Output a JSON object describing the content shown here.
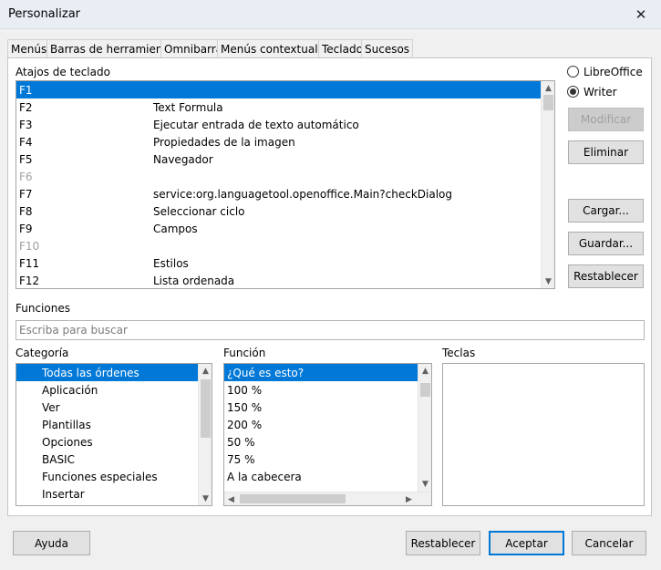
{
  "window": {
    "title": "Personalizar",
    "close_glyph": "✕"
  },
  "tabs": [
    {
      "label": "Menús"
    },
    {
      "label": "Barras de herramientas"
    },
    {
      "label": "Omnibarra"
    },
    {
      "label": "Menús contextuales"
    },
    {
      "label": "Teclado",
      "active": true
    },
    {
      "label": "Sucesos"
    }
  ],
  "shortcuts": {
    "label": "Atajos de teclado",
    "rows": [
      {
        "key": "F1",
        "func": "",
        "selected": true
      },
      {
        "key": "F2",
        "func": "Text Formula"
      },
      {
        "key": "F3",
        "func": "Ejecutar entrada de texto automático"
      },
      {
        "key": "F4",
        "func": "Propiedades de la imagen"
      },
      {
        "key": "F5",
        "func": "Navegador"
      },
      {
        "key": "F6",
        "func": "",
        "disabled": true
      },
      {
        "key": "F7",
        "func": "service:org.languagetool.openoffice.Main?checkDialog"
      },
      {
        "key": "F8",
        "func": "Seleccionar ciclo"
      },
      {
        "key": "F9",
        "func": "Campos"
      },
      {
        "key": "F10",
        "func": "",
        "disabled": true
      },
      {
        "key": "F11",
        "func": "Estilos"
      },
      {
        "key": "F12",
        "func": "Lista ordenada"
      }
    ]
  },
  "scope": {
    "libreoffice_label": "LibreOffice",
    "writer_label": "Writer",
    "selected": "writer"
  },
  "side_buttons": {
    "modificar": "Modificar",
    "eliminar": "Eliminar",
    "cargar": "Cargar...",
    "guardar": "Guardar...",
    "restablecer": "Restablecer"
  },
  "functions": {
    "label": "Funciones",
    "search_placeholder": "Escriba para buscar"
  },
  "categoria": {
    "label": "Categoría",
    "items": [
      {
        "text": "Todas las órdenes",
        "selected": true
      },
      {
        "text": "Aplicación"
      },
      {
        "text": "Ver"
      },
      {
        "text": "Plantillas"
      },
      {
        "text": "Opciones"
      },
      {
        "text": "BASIC"
      },
      {
        "text": "Funciones especiales"
      },
      {
        "text": "Insertar"
      }
    ]
  },
  "funcion": {
    "label": "Función",
    "items": [
      {
        "text": "¿Qué es esto?",
        "selected": true
      },
      {
        "text": "100 %"
      },
      {
        "text": "150 %"
      },
      {
        "text": "200 %"
      },
      {
        "text": "50 %"
      },
      {
        "text": "75 %"
      },
      {
        "text": "A la cabecera"
      }
    ]
  },
  "teclas": {
    "label": "Teclas"
  },
  "footer": {
    "ayuda": "Ayuda",
    "restablecer": "Restablecer",
    "aceptar": "Aceptar",
    "cancelar": "Cancelar"
  }
}
